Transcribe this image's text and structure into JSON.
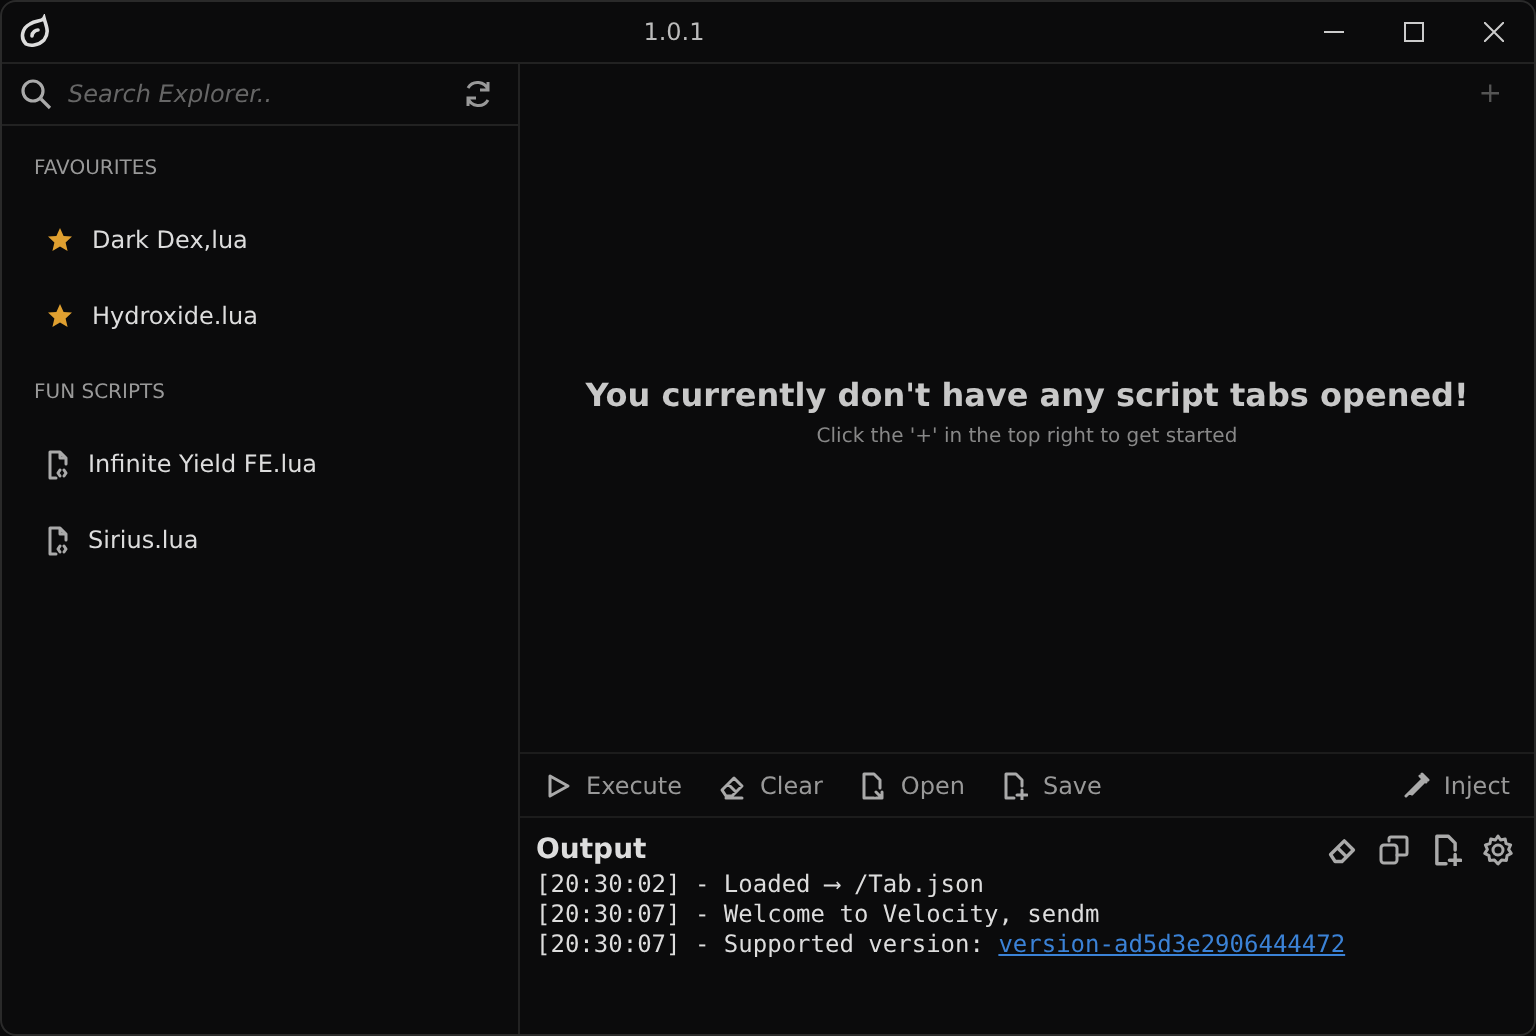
{
  "window": {
    "title": "1.0.1"
  },
  "sidebar": {
    "search": {
      "placeholder": "Search Explorer.."
    },
    "sections": [
      {
        "title": "FAVOURITES",
        "items": [
          {
            "label": "Dark Dex,lua",
            "kind": "favourite"
          },
          {
            "label": "Hydroxide.lua",
            "kind": "favourite"
          }
        ]
      },
      {
        "title": "FUN SCRIPTS",
        "items": [
          {
            "label": "Infinite Yield FE.lua",
            "kind": "script"
          },
          {
            "label": "Sirius.lua",
            "kind": "script"
          }
        ]
      }
    ]
  },
  "editor": {
    "new_tab": "+",
    "empty_title": "You currently don't have any script tabs opened!",
    "empty_hint": "Click the '+' in the top right to get started"
  },
  "toolbar": {
    "left": [
      {
        "label": "Execute",
        "kind": "play"
      },
      {
        "label": "Clear",
        "kind": "eraser"
      },
      {
        "label": "Open",
        "kind": "open"
      },
      {
        "label": "Save",
        "kind": "save"
      }
    ],
    "right": [
      {
        "label": "Inject",
        "kind": "inject"
      }
    ]
  },
  "output": {
    "title": "Output",
    "lines": [
      {
        "text": "[20:30:02] - Loaded ⟶ /Tab.json"
      },
      {
        "text": "[20:30:07] - Welcome to Velocity, sendm"
      },
      {
        "text": "[20:30:07] - Supported version: ",
        "link": "version-ad5d3e2906444472"
      }
    ]
  }
}
